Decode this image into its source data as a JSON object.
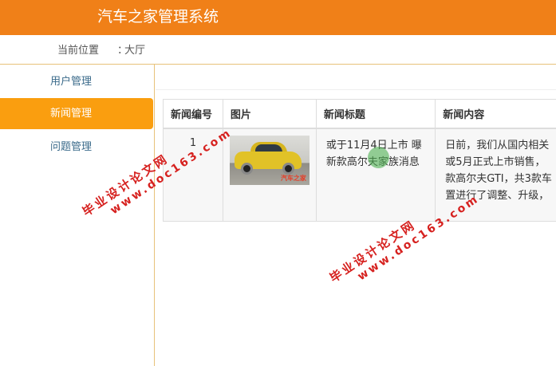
{
  "header": {
    "title": "汽车之家管理系统"
  },
  "breadcrumb": {
    "label": "当前位置",
    "separator": "：",
    "current": "大厅"
  },
  "sidebar": {
    "items": [
      {
        "label": "用户管理",
        "active": false
      },
      {
        "label": "新闻管理",
        "active": true
      },
      {
        "label": "问题管理",
        "active": false
      }
    ]
  },
  "table": {
    "headers": [
      "新闻编号",
      "图片",
      "新闻标题",
      "新闻内容"
    ],
    "rows": [
      {
        "id": "1",
        "image": {
          "alt": "yellow car",
          "stamp": "汽车之家"
        },
        "title": "或于11月4日上市 曝新款高尔夫家族消息",
        "content_lines": [
          "日前，我们从国内相关",
          "或5月正式上市销售，",
          "款高尔夫GTI，共3款车",
          "置进行了调整、升级，"
        ]
      }
    ]
  },
  "watermark": {
    "line1": "毕业设计论文网",
    "line2": "www.doc163.com"
  },
  "colors": {
    "header": "#f08018",
    "active_nav": "#fa9e0f",
    "nav_text": "#3a6a8a",
    "watermark": "#d6211f"
  }
}
